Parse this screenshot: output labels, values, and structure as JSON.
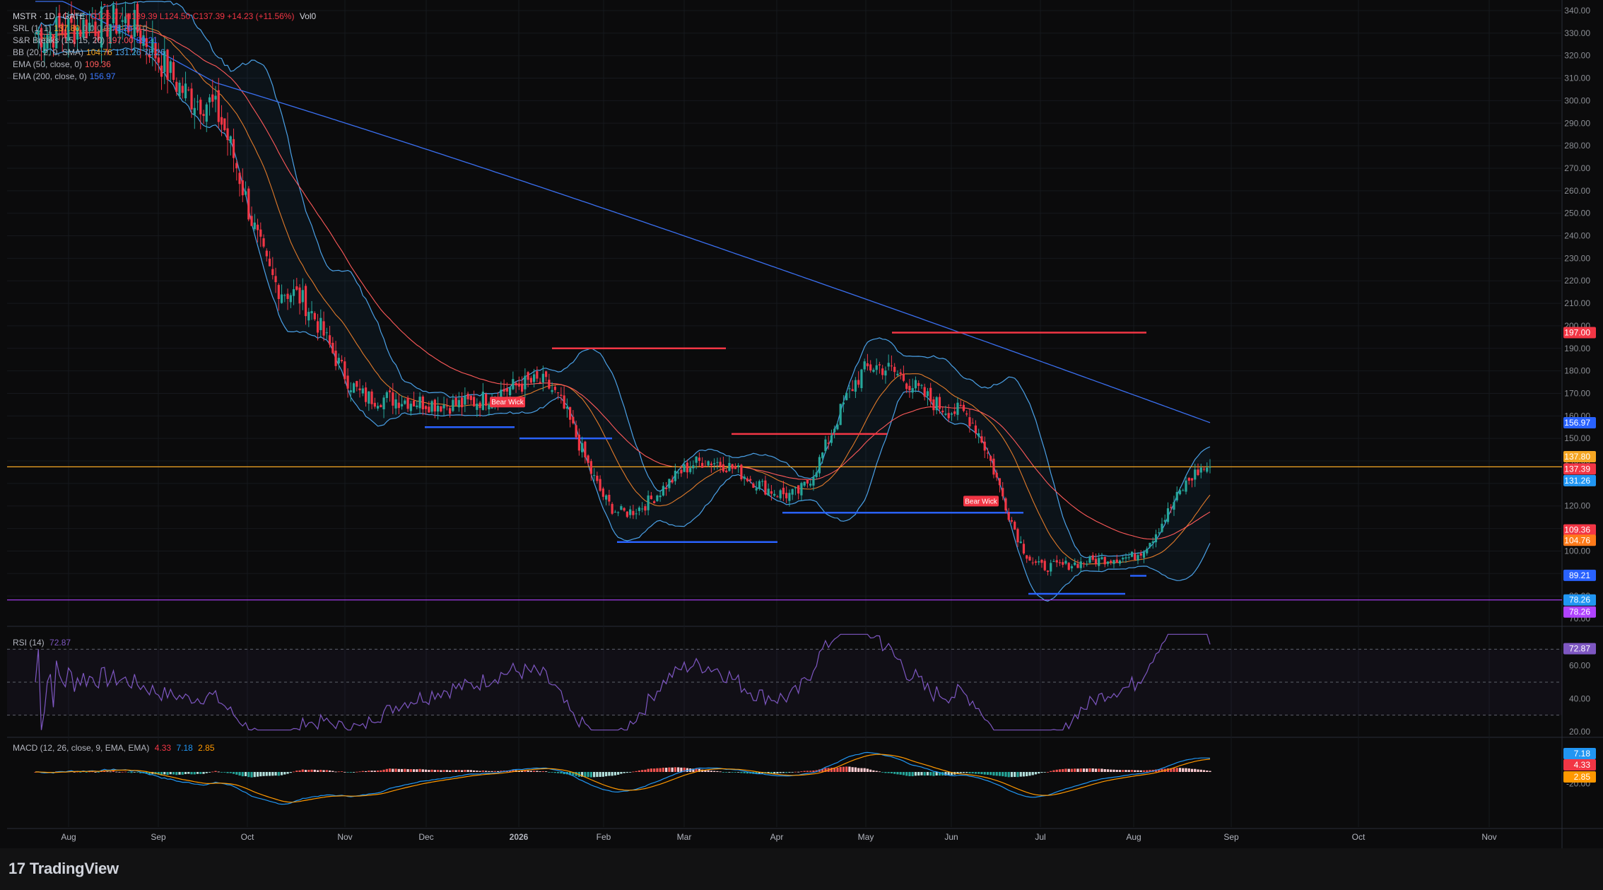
{
  "header": {
    "symbol": "MSTR · 1D · GATE",
    "ohlc_text": "O126.77 H139.39 L124.50 C137.39 +14.23 (+11.56%)",
    "vol": "Vol0"
  },
  "indicators": [
    {
      "name": "SRL (1, 1)",
      "values": [
        "137.80",
        "0 0 0 0",
        "78.26",
        "0 0"
      ],
      "colors": [
        "#f5a623",
        "#8a8d93",
        "#3a78ff",
        "#8a8d93"
      ]
    },
    {
      "name": "S&R Breaks (15, 15, 20)",
      "values": [
        "197.00",
        "89.21"
      ],
      "colors": [
        "#ff4d5a",
        "#3a6bff"
      ]
    },
    {
      "name": "BB (20, 2, 0, SMA)",
      "values": [
        "104.76",
        "131.26",
        "78.26"
      ],
      "colors": [
        "#f5a623",
        "#4aa0e6",
        "#4aa0e6"
      ]
    },
    {
      "name": "EMA (50, close, 0)",
      "values": [
        "109.36"
      ],
      "colors": [
        "#ff5a5a"
      ]
    },
    {
      "name": "EMA (200, close, 0)",
      "values": [
        "156.97"
      ],
      "colors": [
        "#3a78ff"
      ]
    }
  ],
  "rsi_label": "RSI (14)",
  "rsi_value": "72.87",
  "macd_label": "MACD (12, 26, close, 9, EMA, EMA)",
  "macd_values": [
    "4.33",
    "7.18",
    "2.85"
  ],
  "bear_wick_label": "Bear Wick",
  "logo_text": "TradingView",
  "logo_mark": "17",
  "chart_data": {
    "type": "candlestick",
    "symbol": "MSTR",
    "timeframe": "1D",
    "x_ticks": [
      "Aug",
      "Sep",
      "Oct",
      "Nov",
      "Dec",
      "2026",
      "Feb",
      "Mar",
      "Apr",
      "May",
      "Jun",
      "Jul",
      "Aug",
      "Sep",
      "Oct",
      "Nov"
    ],
    "y_ticks": [
      70,
      80,
      90,
      100,
      110,
      120,
      130,
      140,
      150,
      160,
      170,
      180,
      190,
      200,
      210,
      220,
      230,
      240,
      250,
      260,
      270,
      280,
      290,
      300,
      310,
      320,
      330,
      340
    ],
    "ylim": [
      70,
      340
    ],
    "price_path": [
      {
        "month": "Aug",
        "close": 330
      },
      {
        "month": "Sep",
        "close": 335
      },
      {
        "month": "Oct",
        "close": 300
      },
      {
        "month": "Nov",
        "close": 215
      },
      {
        "month": "Dec",
        "close": 168
      },
      {
        "month": "2026",
        "close": 165
      },
      {
        "month": "Jan",
        "close": 175
      },
      {
        "month": "Feb",
        "close": 117
      },
      {
        "month": "Mar",
        "close": 140
      },
      {
        "month": "Apr",
        "close": 125
      },
      {
        "month": "May",
        "close": 182
      },
      {
        "month": "Jun",
        "close": 162
      },
      {
        "month": "Jul",
        "close": 93
      },
      {
        "month": "Aug",
        "close": 97
      },
      {
        "month": "late Aug",
        "close": 137.39
      }
    ],
    "resistance_levels": [
      190,
      152,
      197
    ],
    "support_levels": [
      155,
      150,
      104,
      117,
      81,
      89
    ],
    "horizontal_lines": [
      {
        "value": 137.39,
        "color": "#f5a623"
      },
      {
        "value": 78.26,
        "color": "#b042ff"
      }
    ],
    "price_labels": [
      {
        "value": "197.00",
        "color": "#f23645"
      },
      {
        "value": "156.97",
        "color": "#2962ff"
      },
      {
        "value": "137.80",
        "color": "#f5a623"
      },
      {
        "value": "137.39",
        "color": "#f23645"
      },
      {
        "value": "131.26",
        "color": "#2196f3"
      },
      {
        "value": "109.36",
        "color": "#f23645"
      },
      {
        "value": "104.76",
        "color": "#ff7a1a"
      },
      {
        "value": "89.21",
        "color": "#2962ff"
      },
      {
        "value": "78.26",
        "color": "#2196f3"
      },
      {
        "value": "78.26",
        "color": "#b042ff"
      }
    ],
    "rsi": {
      "ylim": [
        20,
        80
      ],
      "y_ticks": [
        "60.00",
        "40.00",
        "20.00"
      ],
      "overbought": 70,
      "middle": 50,
      "oversold": 30,
      "last": 72.87
    },
    "macd": {
      "y_ticks": [
        "20.00",
        "-20.00"
      ],
      "macd": 7.18,
      "signal": 4.33,
      "histogram": 2.85
    },
    "colors": {
      "up": "#26a69a",
      "down": "#f23645",
      "bb": "#4aa0e6",
      "ema50": "#ff5a5a",
      "ema200": "#3a6ff0"
    }
  }
}
